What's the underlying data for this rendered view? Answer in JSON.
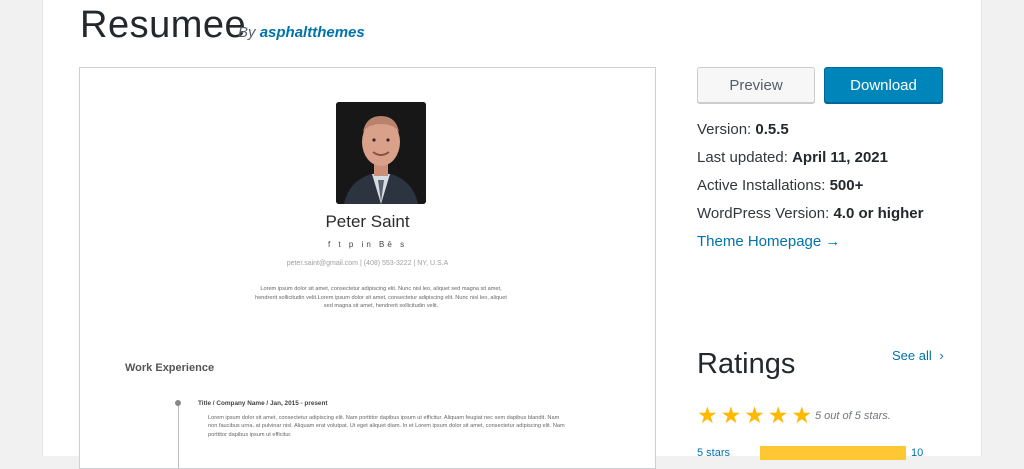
{
  "theme": {
    "title": "Resumee",
    "by_prefix": "By",
    "author": "asphaltthemes"
  },
  "screenshot": {
    "name": "Peter Saint",
    "social_icons": [
      "f",
      "t",
      "p",
      "in",
      "Bē",
      "s"
    ],
    "social_icon_names": [
      "facebook-icon",
      "twitter-icon",
      "pinterest-icon",
      "linkedin-icon",
      "behance-icon",
      "skype-icon"
    ],
    "contact": "peter.saint@gmail.com | (408) 553-3222 | NY, U.S.A",
    "about": "Lorem ipsum dolor sit amet, consectetur adipiscing elit. Nunc nisl leo, aliquet sed magna sit amet, hendrerit sollicitudin velit.Lorem ipsum dolor sit amet, consectetur adipiscing elit. Nunc nisl leo, aliquet sed magna sit amet, hendrerit sollicitudin velit.",
    "section_title": "Work Experience",
    "job_title": "Title / Company Name / Jan, 2015 - present",
    "job_description": "Lorem ipsum dolor sit amet, consectetur adipiscing elit. Nam porttitor dapibus ipsum ut efficitur. Aliquam feugiat nec sem dapibus blandit. Nam non faucibus urna, at pulvinar nisl. Aliquam erat volutpat. Ut eget aliquet diam. In et Lorem ipsum dolor sit amet, consectetur adipiscing elit. Nam porttitor dapibus ipsum ut efficitur."
  },
  "actions": {
    "preview_label": "Preview",
    "download_label": "Download"
  },
  "meta": {
    "version_label": "Version:",
    "version_value": "0.5.5",
    "updated_label": "Last updated:",
    "updated_value": "April 11, 2021",
    "installs_label": "Active Installations:",
    "installs_value": "500+",
    "wp_label": "WordPress Version:",
    "wp_value": "4.0 or higher",
    "homepage_link": "Theme Homepage →"
  },
  "ratings": {
    "title": "Ratings",
    "see_all": "See all",
    "see_all_icon": "chevron-right-icon",
    "stars_filled": 5,
    "stars_total": 5,
    "summary": "5 out of 5 stars.",
    "bars": [
      {
        "label": "5 stars",
        "count": "10",
        "fraction": 1.0
      }
    ]
  },
  "colors": {
    "accent": "#0073aa",
    "download_bg": "#0085ba",
    "star": "#ffb900",
    "bar_fill": "#ffc733"
  }
}
